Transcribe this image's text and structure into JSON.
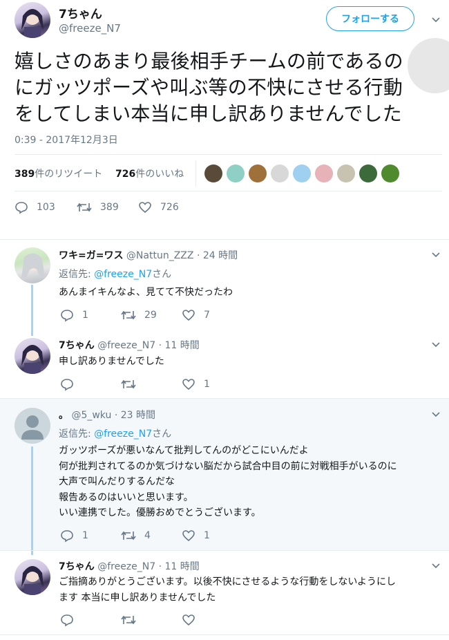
{
  "main_tweet": {
    "display_name": "7ちゃん",
    "handle": "@freeze_N7",
    "follow_label": "フォローする",
    "text_lines": [
      "嬉しさのあまり最後相手チームの前であるの",
      "にガッツポーズや叫ぶ等の不快にさせる行動",
      "をしてしまい本当に申し訳ありませんでした"
    ],
    "timestamp": "0:39 - 2017年12月3日",
    "stats": {
      "retweet_count": "389",
      "retweet_label": "件のリツイート",
      "like_count": "726",
      "like_label": "件のいいね"
    },
    "actions": {
      "replies": "103",
      "retweets": "389",
      "likes": "726"
    }
  },
  "replies": [
    {
      "display_name": "ワキ=ガ=ワス",
      "handle": "@Nattun_ZZZ",
      "time": "· 24 時間",
      "reply_to_prefix": "返信先: ",
      "reply_to_handle": "@freeze_N7",
      "reply_to_suffix": "さん",
      "lines": [
        "あんまイキんなよ、見てて不快だったわ"
      ],
      "actions": {
        "replies": "1",
        "retweets": "29",
        "likes": "7"
      }
    },
    {
      "display_name": "7ちゃん",
      "handle": "@freeze_N7",
      "time": "· 11 時間",
      "lines": [
        "申し訳ありませんでした"
      ],
      "actions": {
        "replies": "",
        "retweets": "",
        "likes": "1"
      }
    },
    {
      "display_name": "。",
      "handle": "@5_wku",
      "time": "· 23 時間",
      "reply_to_prefix": "返信先: ",
      "reply_to_handle": "@freeze_N7",
      "reply_to_suffix": "さん",
      "lines": [
        "ガッツポーズが悪いなんて批判してんのがどこにいんだよ",
        "何が批判されてるのか気づけない脳だから試合中目の前に対戦相手がいるのに",
        "大声で叫んだりするんだな",
        "報告あるのはいいと思います。",
        "いい連携でした。優勝おめでとうございます。"
      ],
      "actions": {
        "replies": "1",
        "retweets": "4",
        "likes": "1"
      }
    },
    {
      "display_name": "7ちゃん",
      "handle": "@freeze_N7",
      "time": "· 11 時間",
      "lines": [
        "ご指摘ありがとうございます。以後不快にさせるような行動をしないようにし",
        "ます 本当に申し訳ありませんでした"
      ],
      "actions": {
        "replies": "",
        "retweets": "",
        "likes": ""
      }
    }
  ],
  "colors": {
    "accent": "#1da1f2",
    "muted": "#657786",
    "thread": "#9fd5f7",
    "highlight": "#f5f8fa"
  }
}
